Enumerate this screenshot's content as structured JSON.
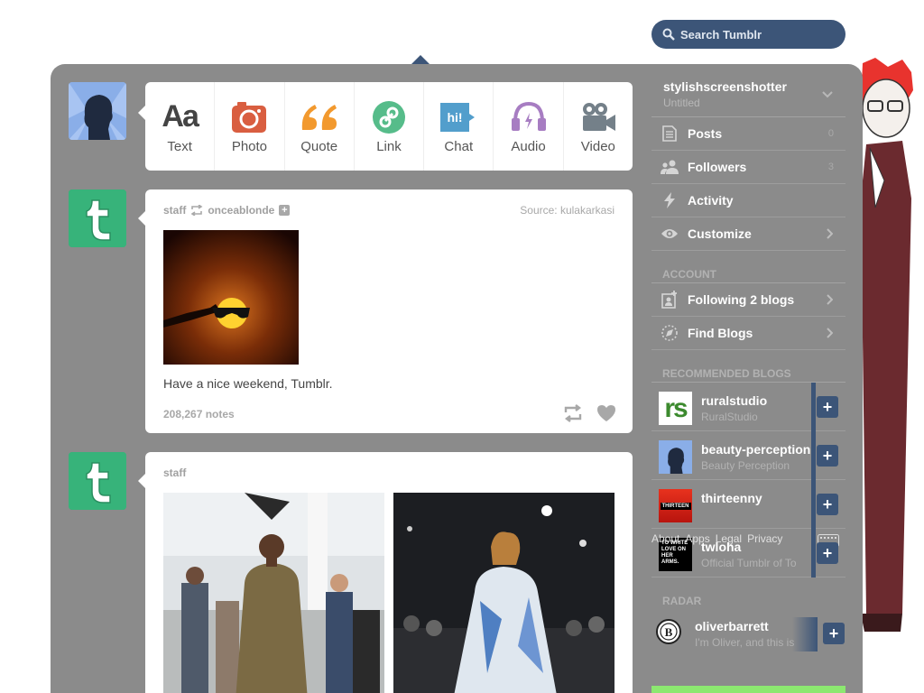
{
  "search": {
    "placeholder": "Search Tumblr"
  },
  "composer": {
    "types": [
      {
        "label": "Text",
        "glyph": "Aa",
        "color": "#444444"
      },
      {
        "label": "Photo",
        "color": "#d95e40"
      },
      {
        "label": "Quote",
        "glyph": "66",
        "color": "#f2992e"
      },
      {
        "label": "Link",
        "color": "#56bc8a"
      },
      {
        "label": "Chat",
        "glyph": "hi!",
        "color": "#529ecc"
      },
      {
        "label": "Audio",
        "color": "#a77dc2"
      },
      {
        "label": "Video",
        "color": "#748089"
      }
    ]
  },
  "post1": {
    "author": "staff",
    "reblogged_from": "onceablonde",
    "source_label": "Source:",
    "source_name": "kulakarkasi",
    "caption": "Have a nice weekend, Tumblr.",
    "notes": "208,267 notes"
  },
  "post2": {
    "author": "staff"
  },
  "sidebar": {
    "blog_name": "stylishscreenshotter",
    "blog_title": "Untitled",
    "items": [
      {
        "label": "Posts",
        "count": "0"
      },
      {
        "label": "Followers",
        "count": "3"
      },
      {
        "label": "Activity"
      },
      {
        "label": "Customize"
      }
    ],
    "account_heading": "ACCOUNT",
    "account_items": [
      {
        "label": "Following 2 blogs"
      },
      {
        "label": "Find Blogs"
      }
    ],
    "recommended_heading": "RECOMMENDED BLOGS",
    "recommended": [
      {
        "name": "ruralstudio",
        "subtitle": "RuralStudio",
        "avatar_text": "rs"
      },
      {
        "name": "beauty-perception",
        "subtitle": "Beauty Perception"
      },
      {
        "name": "thirteenny",
        "subtitle": "",
        "avatar_text": "THIRTEEN"
      },
      {
        "name": "twloha",
        "subtitle": "Official Tumblr of To",
        "avatar_text": "TO WRITE LOVE ON HER ARMS."
      }
    ],
    "footer_links": [
      "About",
      "Apps",
      "Legal",
      "Privacy"
    ],
    "radar_heading": "RADAR",
    "radar": {
      "name": "oliverbarrett",
      "subtitle": "I'm Oliver, and this is",
      "avatar_text": "B"
    }
  },
  "colors": {
    "panel": "#8b8b8b",
    "accent": "#3c5578",
    "staff_green": "#37b37a",
    "radar_bar": "#8ce870"
  }
}
